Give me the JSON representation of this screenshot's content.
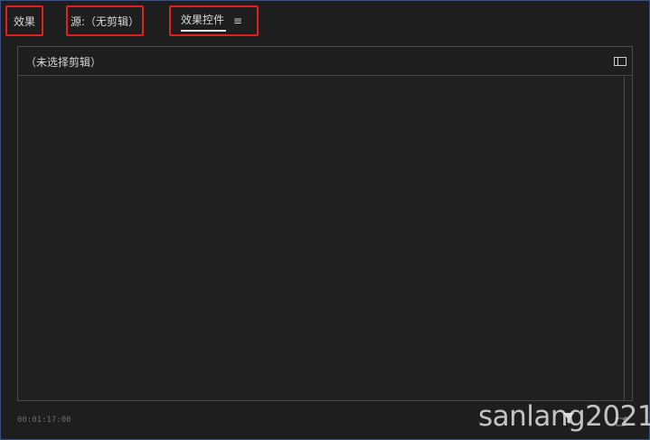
{
  "tabs": {
    "effects": "效果",
    "source": "源:（无剪辑）",
    "effect_controls": "效果控件",
    "menu_icon": "≡"
  },
  "panel": {
    "title": "（未选择剪辑）"
  },
  "footer": {
    "timecode": "00:01:17:00",
    "watermark": "sanlang2021"
  }
}
